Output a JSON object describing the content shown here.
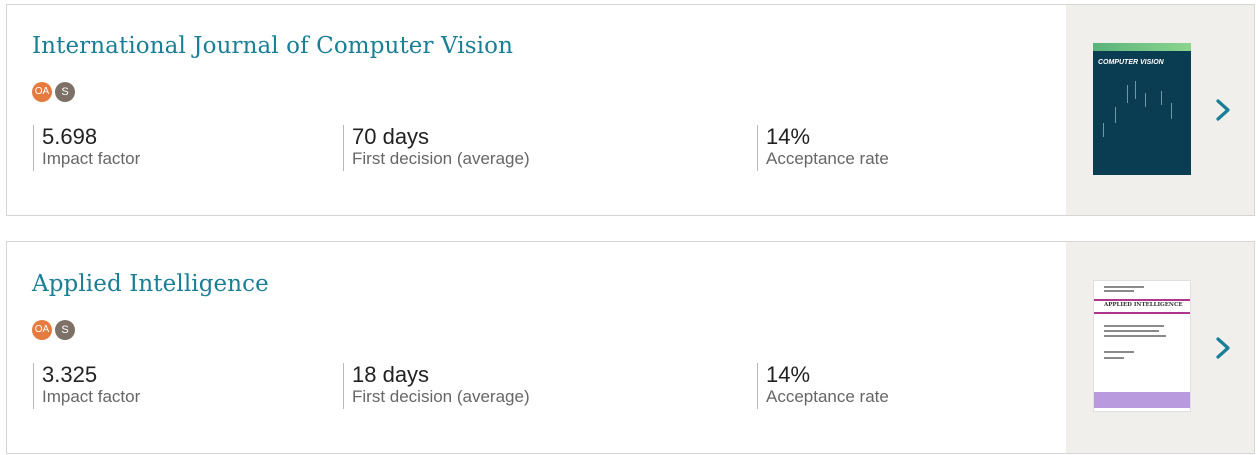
{
  "journals": [
    {
      "title": "International Journal of Computer Vision",
      "badges": [
        "OA",
        "S"
      ],
      "metrics": [
        {
          "value": "5.698",
          "label": "Impact factor"
        },
        {
          "value": "70 days",
          "label": "First decision (average)"
        },
        {
          "value": "14%",
          "label": "Acceptance rate"
        }
      ],
      "cover_title": "COMPUTER VISION"
    },
    {
      "title": "Applied Intelligence",
      "badges": [
        "OA",
        "S"
      ],
      "metrics": [
        {
          "value": "3.325",
          "label": "Impact factor"
        },
        {
          "value": "18 days",
          "label": "First decision (average)"
        },
        {
          "value": "14%",
          "label": "Acceptance rate"
        }
      ],
      "cover_title": "APPLIED INTELLIGENCE"
    }
  ],
  "icons": {
    "next": "chevron-right-icon"
  },
  "colors": {
    "title": "#1a7f96",
    "oa_badge": "#e57b3f",
    "s_badge": "#7d7167",
    "chevron": "#1a7f96"
  }
}
